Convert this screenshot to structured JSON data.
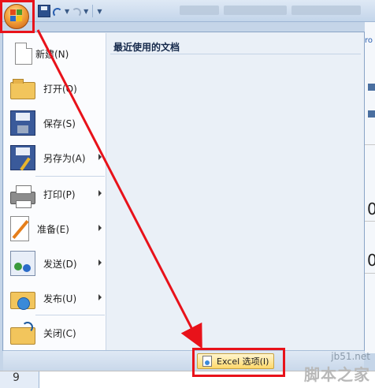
{
  "menu": {
    "items": [
      {
        "label": "新建(N)",
        "icon": "new-document-icon",
        "submenu": false
      },
      {
        "label": "打开(O)",
        "icon": "open-folder-icon",
        "submenu": false
      },
      {
        "label": "保存(S)",
        "icon": "save-floppy-icon",
        "submenu": false
      },
      {
        "label": "另存为(A)",
        "icon": "save-as-icon",
        "submenu": true
      },
      {
        "label": "打印(P)",
        "icon": "printer-icon",
        "submenu": true
      },
      {
        "label": "准备(E)",
        "icon": "prepare-icon",
        "submenu": true
      },
      {
        "label": "发送(D)",
        "icon": "send-icon",
        "submenu": true
      },
      {
        "label": "发布(U)",
        "icon": "publish-icon",
        "submenu": true
      },
      {
        "label": "关闭(C)",
        "icon": "close-folder-icon",
        "submenu": false
      }
    ],
    "recent_title": "最近使用的文档",
    "options_label": "Excel 选项(I)"
  },
  "sheet": {
    "row_number": "9"
  },
  "background_cells": {
    "r1": "ro",
    "c1": "0",
    "c2": "0"
  },
  "watermark": {
    "url": "jb51.net",
    "name": "脚本之家"
  },
  "colors": {
    "highlight": "#e8121a",
    "accent": "#f3a13a"
  }
}
